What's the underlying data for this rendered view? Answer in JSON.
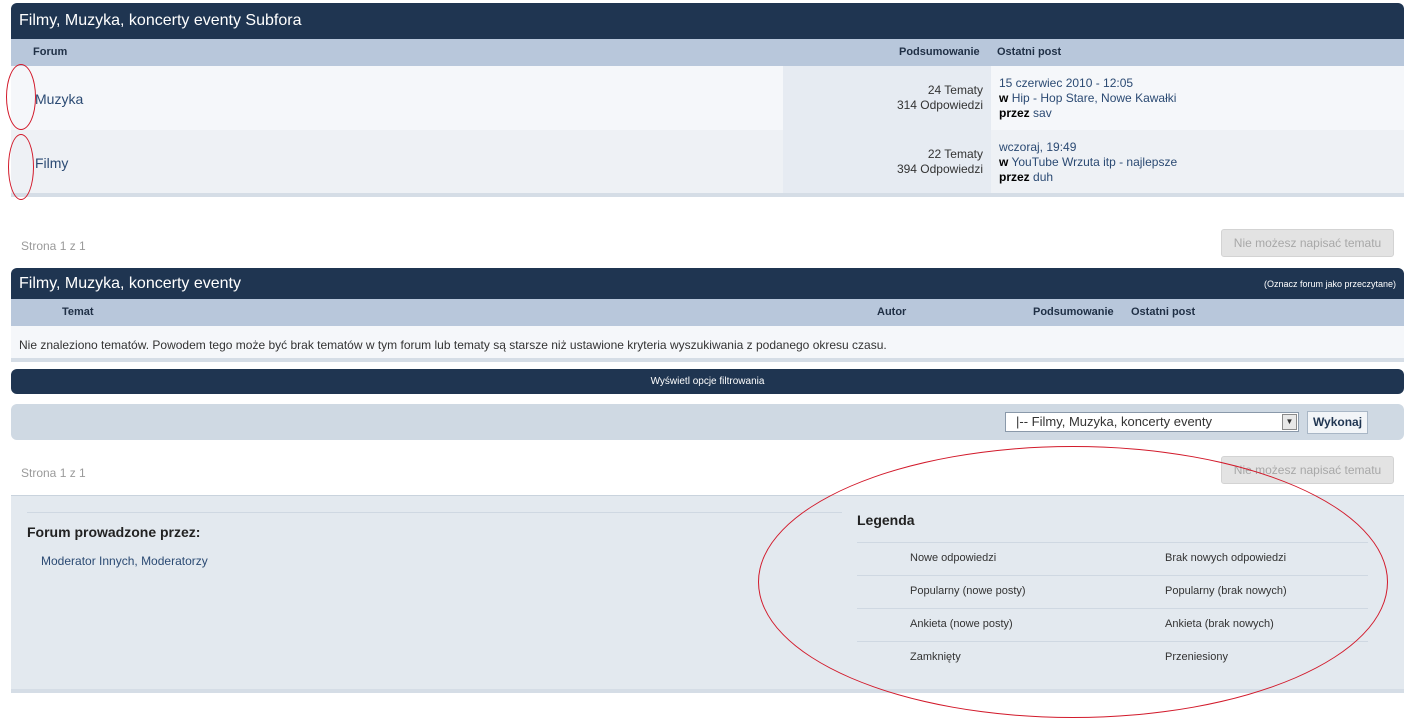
{
  "subforums": {
    "title": "Filmy, Muzyka, koncerty eventy Subfora",
    "headers": {
      "forum": "Forum",
      "summary": "Podsumowanie",
      "last_post": "Ostatni post"
    },
    "rows": [
      {
        "name": "Muzyka",
        "topics": "24 Tematy",
        "replies": "314 Odpowiedzi",
        "last_date": "15 czerwiec 2010 - 12:05",
        "in_label": "w",
        "last_topic": "Hip - Hop Stare, Nowe Kawałki",
        "by_label": "przez",
        "last_author": "sav"
      },
      {
        "name": "Filmy",
        "topics": "22 Tematy",
        "replies": "394 Odpowiedzi",
        "last_date": "wczoraj, 19:49",
        "in_label": "w",
        "last_topic": "YouTube Wrzuta itp - najlepsze",
        "by_label": "przez",
        "last_author": "duh"
      }
    ]
  },
  "pagination": {
    "page_text": "Strona 1 z 1",
    "new_topic_disabled": "Nie możesz napisać tematu"
  },
  "topics": {
    "title": "Filmy, Muzyka, koncerty eventy",
    "mark_read": "(Oznacz forum jako przeczytane)",
    "headers": {
      "topic": "Temat",
      "author": "Autor",
      "summary": "Podsumowanie",
      "last_post": "Ostatni post"
    },
    "empty_message": "Nie znaleziono tematów. Powodem tego może być brak tematów w tym forum lub tematy są starsze niż ustawione kryteria wyszukiwania z podanego okresu czasu."
  },
  "filter": {
    "label": "Wyświetl opcje filtrowania"
  },
  "jump": {
    "selected": "|-- Filmy, Muzyka, koncerty eventy",
    "go": "Wykonaj"
  },
  "moderators": {
    "heading": "Forum prowadzone przez:",
    "list": [
      "Moderator Innych,",
      "Moderatorzy"
    ]
  },
  "legend": {
    "heading": "Legenda",
    "rows": [
      [
        "Nowe odpowiedzi",
        "Brak nowych odpowiedzi"
      ],
      [
        "Popularny (nowe posty)",
        "Popularny (brak nowych)"
      ],
      [
        "Ankieta (nowe posty)",
        "Ankieta (brak nowych)"
      ],
      [
        "Zamknięty",
        "Przeniesiony"
      ]
    ]
  },
  "colors": {
    "header_dark": "#1f3551",
    "header_light": "#b8c7db",
    "annotation_red": "#d21a2b"
  }
}
